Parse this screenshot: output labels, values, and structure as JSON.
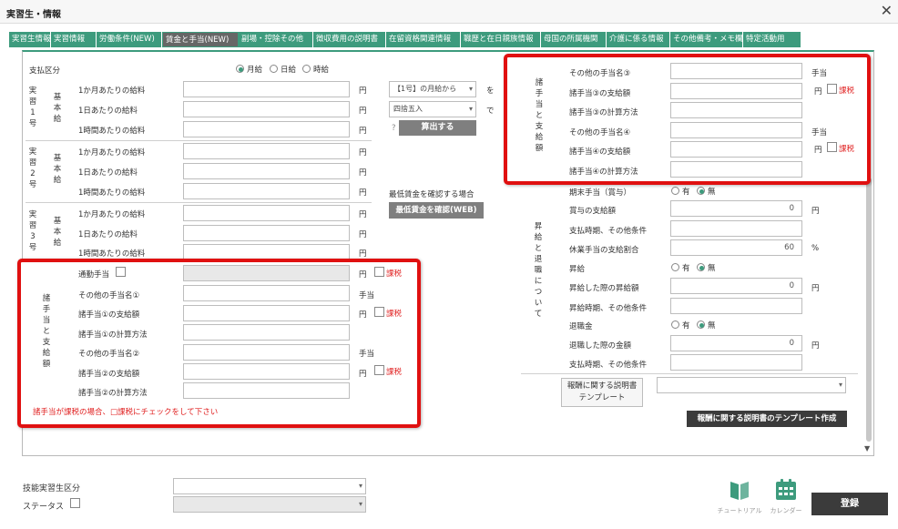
{
  "window": {
    "title": "実習生・情報",
    "close": "✕"
  },
  "tabs": [
    "実習生情報",
    "実習情報",
    "労働条件(NEW)",
    "賃金と手当(NEW)",
    "副場・控除その他",
    "徴収費用の説明書",
    "在留資格関連情報",
    "職歴と在日親族情報",
    "母国の所属機関",
    "介護に係る情報",
    "その他備考・メモ欄",
    "特定活動用"
  ],
  "pay": {
    "label": "支払区分",
    "options": [
      "月給",
      "日給",
      "時給"
    ],
    "selected": "月給"
  },
  "groups": [
    {
      "vlabel": [
        "実",
        "習",
        "1",
        "号"
      ],
      "kind": [
        "基",
        "本",
        "給"
      ],
      "rows": [
        "1か月あたりの給料",
        "1日あたりの給料",
        "1時間あたりの給料"
      ]
    },
    {
      "vlabel": [
        "実",
        "習",
        "2",
        "号"
      ],
      "kind": [
        "基",
        "本",
        "給"
      ],
      "rows": [
        "1か月あたりの給料",
        "1日あたりの給料",
        "1時間あたりの給料"
      ]
    },
    {
      "vlabel": [
        "実",
        "習",
        "3",
        "号"
      ],
      "kind": [
        "基",
        "本",
        "給"
      ],
      "rows": [
        "1か月あたりの給料",
        "1日あたりの給料",
        "1時間あたりの給料"
      ]
    }
  ],
  "yen": "円",
  "calc": {
    "sel1": "【1号】の月給から",
    "wo": "を",
    "sel2": "四捨五入",
    "de": "で",
    "q": "?",
    "btn": "算出する",
    "minwage_label": "最低賃金を確認する場合",
    "minwage_btn": "最低賃金を確認(WEB)"
  },
  "allow_left": {
    "vlabel": [
      "諸",
      "手",
      "当",
      "と",
      "支",
      "給",
      "額"
    ],
    "commute": "通勤手当",
    "name1": "その他の手当名①",
    "amt1": "諸手当①の支給額",
    "method1": "諸手当①の計算方法",
    "name2": "その他の手当名②",
    "amt2": "諸手当②の支給額",
    "method2": "諸手当②の計算方法",
    "teate": "手当",
    "kazei": "課税",
    "note": "諸手当が課税の場合、□課税にチェックをして下さい"
  },
  "allow_right": {
    "vlabel": [
      "諸",
      "手",
      "当",
      "と",
      "支",
      "給",
      "額"
    ],
    "name3": "その他の手当名③",
    "amt3": "諸手当③の支給額",
    "method3": "諸手当③の計算方法",
    "name4": "その他の手当名④",
    "amt4": "諸手当④の支給額",
    "method4": "諸手当④の計算方法",
    "teate": "手当",
    "kazei": "課税"
  },
  "bonus": {
    "vlabel": [
      "昇",
      "給",
      "と",
      "退",
      "職",
      "に",
      "つ",
      "い",
      "て"
    ],
    "bonus_label": "期末手当（賞与）",
    "yes": "有",
    "no": "無",
    "bonus_amount": "賞与の支給額",
    "bonus_amount_val": "0",
    "pay_time": "支払時期、その他条件",
    "leave": "休業手当の支給割合",
    "leave_val": "60",
    "pct": "%",
    "raise": "昇給",
    "raise_amount": "昇給した際の昇給額",
    "raise_amount_val": "0",
    "raise_time": "昇給時期、その他条件",
    "retire": "退職金",
    "retire_amount": "退職した際の金額",
    "retire_amount_val": "0",
    "retire_time": "支払時期、その他条件"
  },
  "template": {
    "label_line1": "報酬に関する説明書",
    "label_line2": "テンプレート",
    "btn": "報酬に関する説明書のテンプレート作成"
  },
  "bottom": {
    "trainee_type": "技能実習生区分",
    "status": "ステータス",
    "tutorial": "チュートリアル",
    "calendar": "カレンダー",
    "register": "登録"
  },
  "colors": {
    "accent": "#3d9b7d",
    "highlight": "#e01010",
    "kazei": "#e02020"
  }
}
